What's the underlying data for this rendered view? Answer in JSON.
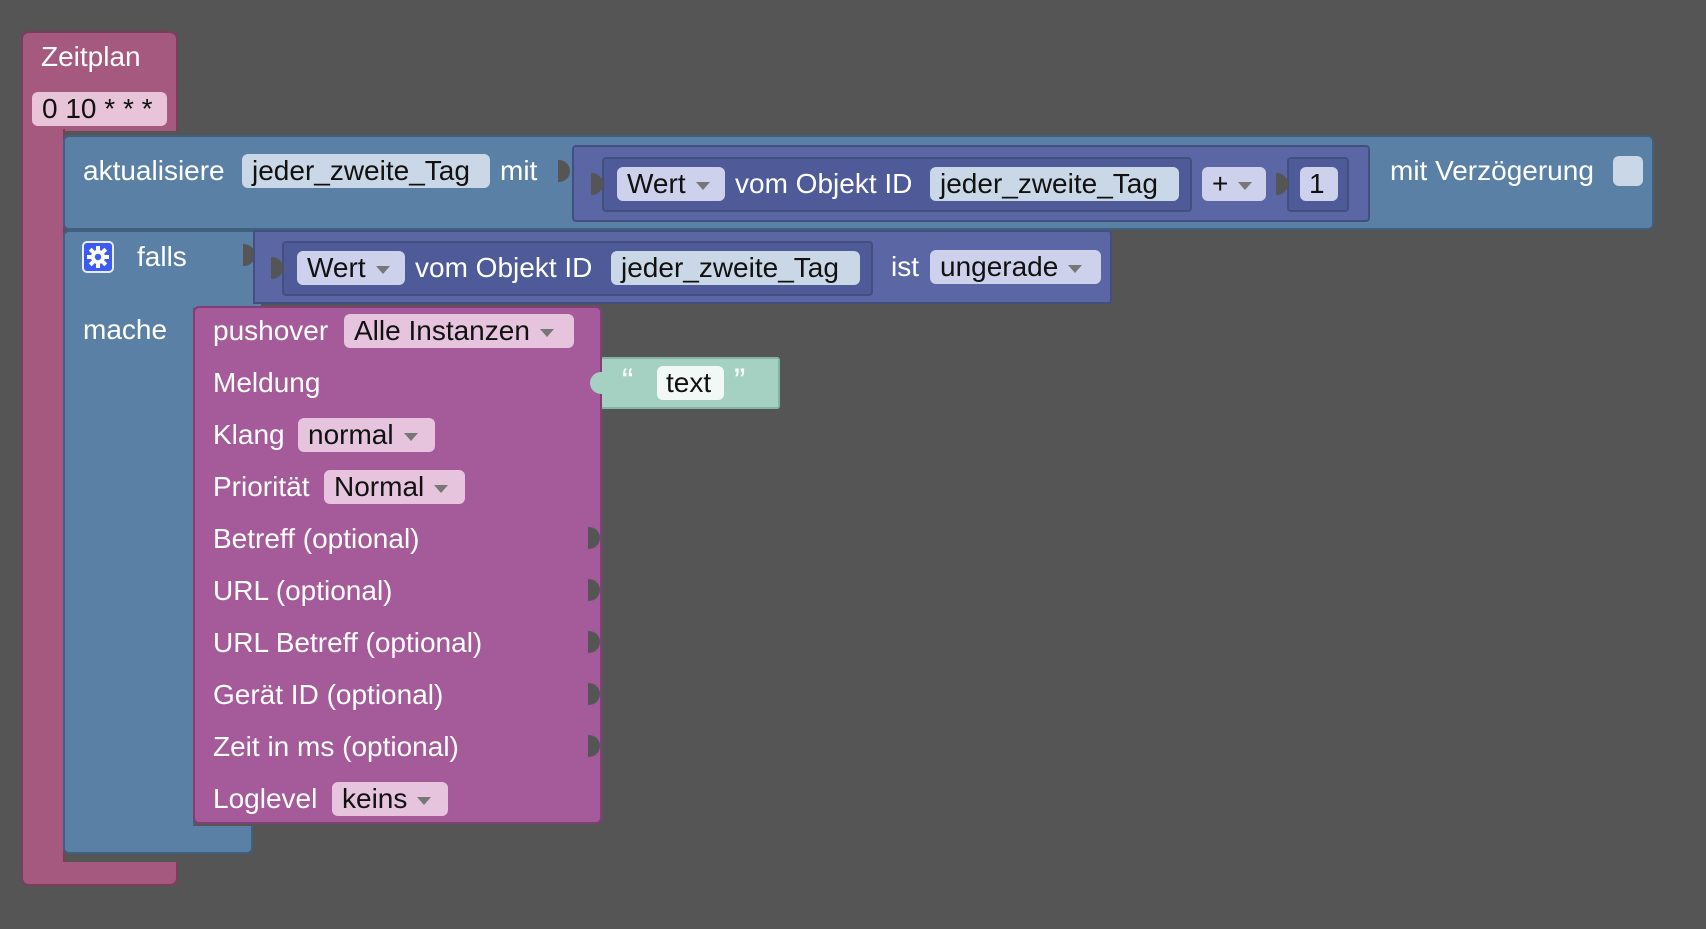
{
  "schedule_block": {
    "label": "Zeitplan",
    "cron": "0 10 * * *"
  },
  "update_block": {
    "label": "aktualisiere",
    "variable": "jeder_zweite_Tag",
    "with_label": "mit",
    "delay_label": "mit Verzögerung",
    "expression": {
      "value_dropdown": "Wert",
      "object_label": "vom Objekt ID",
      "object_id": "jeder_zweite_Tag",
      "operator": "+",
      "operand": "1"
    }
  },
  "if_block": {
    "if_label": "falls",
    "do_label": "mache",
    "condition": {
      "value_dropdown": "Wert",
      "object_label": "vom Objekt ID",
      "object_id": "jeder_zweite_Tag",
      "is_label": "ist",
      "check_dropdown": "ungerade"
    }
  },
  "pushover_block": {
    "label": "pushover",
    "instance": "Alle Instanzen",
    "message_label": "Meldung",
    "sound_label": "Klang",
    "sound_value": "normal",
    "priority_label": "Priorität",
    "priority_value": "Normal",
    "subject_label": "Betreff (optional)",
    "url_label": "URL (optional)",
    "url_subject_label": "URL Betreff (optional)",
    "device_label": "Gerät ID (optional)",
    "time_label": "Zeit in ms (optional)",
    "loglevel_label": "Loglevel",
    "loglevel_value": "keins"
  },
  "text_block": {
    "open_quote": "“",
    "value": "text",
    "close_quote": "”"
  },
  "colors": {
    "background": "#555555",
    "schedule": "#a5597f",
    "logic_blue": "#5b80a5",
    "objects_indigo": "#5b67a5",
    "pushover": "#a55b99",
    "text": "#a5d1c3"
  }
}
